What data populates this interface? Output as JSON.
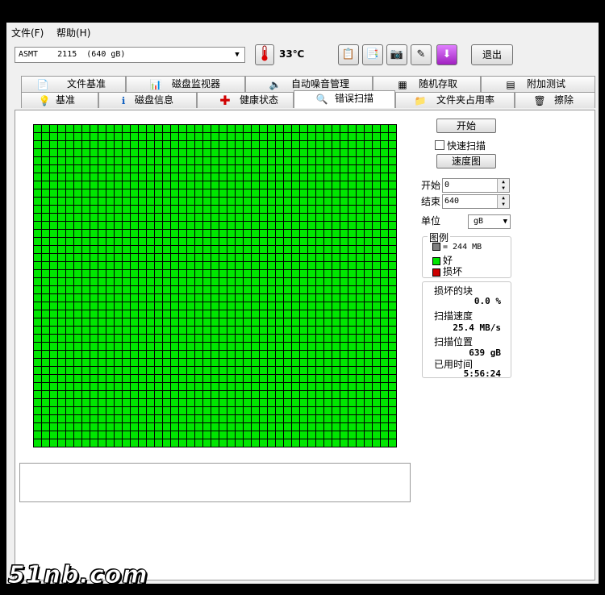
{
  "menu": {
    "file": "文件(F)",
    "help": "帮助(H)"
  },
  "toolbar": {
    "drive": "ASMT    2115  (640 gB)",
    "temperature": "33℃",
    "exit_label": "退出"
  },
  "tabs_top": [
    {
      "label": "文件基准",
      "icon": "file-benchmark-icon"
    },
    {
      "label": "磁盘监视器",
      "icon": "disk-monitor-icon"
    },
    {
      "label": "自动噪音管理",
      "icon": "speaker-icon"
    },
    {
      "label": "随机存取",
      "icon": "random-access-icon"
    },
    {
      "label": "附加测试",
      "icon": "extra-tests-icon"
    }
  ],
  "tabs_bottom": [
    {
      "label": "基准",
      "icon": "bulb-icon"
    },
    {
      "label": "磁盘信息",
      "icon": "info-icon"
    },
    {
      "label": "健康状态",
      "icon": "health-cross-icon"
    },
    {
      "label": "错误扫描",
      "icon": "magnifier-icon",
      "active": true
    },
    {
      "label": "文件夹占用率",
      "icon": "folder-icon"
    },
    {
      "label": "擦除",
      "icon": "trash-icon"
    }
  ],
  "scan": {
    "start_button": "开始",
    "quick_scan_label": "快速扫描",
    "quick_scan_checked": false,
    "speed_map_button": "速度图",
    "start_label": "开始",
    "start_value": "0",
    "end_label": "结束",
    "end_value": "640",
    "unit_label": "单位",
    "unit_value": "gB",
    "legend_title": "图例",
    "legend_block": "= 244 MB",
    "legend_good": "好",
    "legend_bad": "损坏",
    "damaged_blocks_label": "损坏的块",
    "damaged_blocks_value": "0.0 %",
    "scan_speed_label": "扫描速度",
    "scan_speed_value": "25.4 MB/s",
    "scan_position_label": "扫描位置",
    "scan_position_value": "639 gB",
    "elapsed_label": "已用时间",
    "elapsed_value": "5:56:24"
  },
  "colors": {
    "good": "#00e600",
    "bad": "#cc0000",
    "block": "#808080"
  },
  "watermark": "51nb.com"
}
